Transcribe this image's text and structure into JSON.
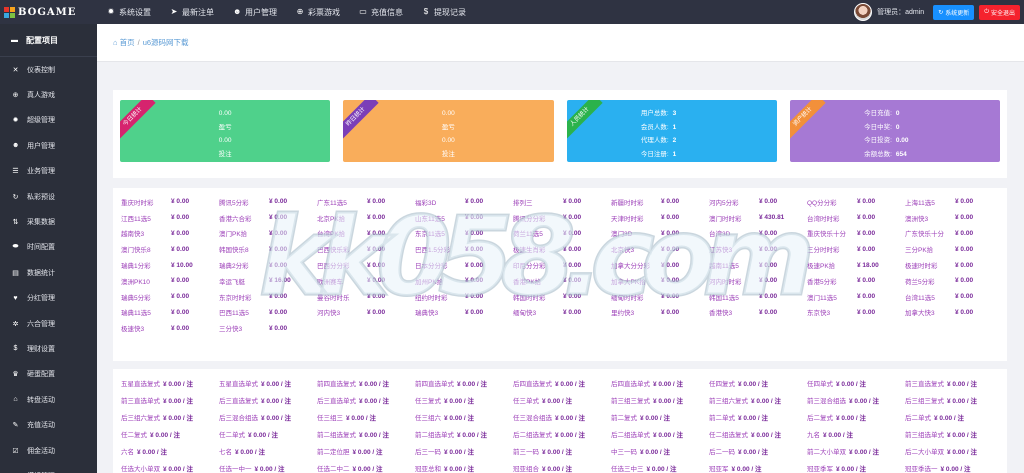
{
  "brand": {
    "logo_text": "BOGAME",
    "logo_colors": [
      "#e8352a",
      "#f7a31c",
      "#3aa8e0",
      "#7dc242"
    ]
  },
  "topnav": [
    {
      "label": "系统设置",
      "icon": "gear-icon",
      "glyph": "✹"
    },
    {
      "label": "最新注单",
      "icon": "paper-plane-icon",
      "glyph": "➤"
    },
    {
      "label": "用户管理",
      "icon": "user-icon",
      "glyph": "☻"
    },
    {
      "label": "彩票游戏",
      "icon": "plus-circle-icon",
      "glyph": "⊕"
    },
    {
      "label": "充值信息",
      "icon": "card-icon",
      "glyph": "▭"
    },
    {
      "label": "提现记录",
      "icon": "dollar-icon",
      "glyph": "$"
    }
  ],
  "top_right": {
    "admin_label": "管理员：admin",
    "update_btn": "系统更新",
    "logout_btn": "安全退出"
  },
  "sidebar": {
    "title": "配置项目",
    "items": [
      {
        "label": "仪表控制",
        "icon": "shuffle-icon",
        "glyph": "✕"
      },
      {
        "label": "真人游戏",
        "icon": "plus-circle-icon",
        "glyph": "⊕"
      },
      {
        "label": "超级管理",
        "icon": "gear-icon",
        "glyph": "✹"
      },
      {
        "label": "用户管理",
        "icon": "user-icon",
        "glyph": "☻"
      },
      {
        "label": "业务管理",
        "icon": "list-icon",
        "glyph": "☰"
      },
      {
        "label": "私彩预设",
        "icon": "refresh-icon",
        "glyph": "↻"
      },
      {
        "label": "采集数据",
        "icon": "sort-icon",
        "glyph": "⇅"
      },
      {
        "label": "时间配置",
        "icon": "car-icon",
        "glyph": "⬬"
      },
      {
        "label": "数据统计",
        "icon": "chart-icon",
        "glyph": "▤"
      },
      {
        "label": "分红管理",
        "icon": "heart-icon",
        "glyph": "♥"
      },
      {
        "label": "六合管理",
        "icon": "cog-icon",
        "glyph": "✲"
      },
      {
        "label": "理财设置",
        "icon": "dollar-icon",
        "glyph": "$"
      },
      {
        "label": "砸蛋配置",
        "icon": "trophy-icon",
        "glyph": "♛"
      },
      {
        "label": "转盘活动",
        "icon": "bank-icon",
        "glyph": "⌂"
      },
      {
        "label": "充值活动",
        "icon": "edit-icon",
        "glyph": "✎"
      },
      {
        "label": "佣金活动",
        "icon": "check-square-icon",
        "glyph": "☑"
      },
      {
        "label": "模板管理",
        "icon": "grid-icon",
        "glyph": "▦"
      }
    ]
  },
  "breadcrumb": {
    "home": "首页",
    "separator": "/",
    "current": "u6源码网下载"
  },
  "stats": [
    {
      "ribbon": "今日统计",
      "color": "#4fd18b",
      "ribbon_color": "#d6246e",
      "layout": "center",
      "lines": [
        "0.00",
        "盈亏",
        "0.00",
        "投注"
      ]
    },
    {
      "ribbon": "昨日统计",
      "color": "#f9ad5b",
      "ribbon_color": "#7b3fb8",
      "layout": "center",
      "lines": [
        "0.00",
        "盈亏",
        "0.00",
        "投注"
      ]
    },
    {
      "ribbon": "人员统计",
      "color": "#2ab0f0",
      "ribbon_color": "#2bb24c",
      "layout": "kv",
      "lines": [
        [
          "用户总数:",
          "3"
        ],
        [
          "会员人数:",
          "1"
        ],
        [
          "代理人数:",
          "2"
        ],
        [
          "今日注册:",
          "1"
        ]
      ]
    },
    {
      "ribbon": "资产统计",
      "color": "#a679d4",
      "ribbon_color": "#f2903a",
      "layout": "kv",
      "lines": [
        [
          "今日充值:",
          "0"
        ],
        [
          "今日中奖:",
          "0"
        ],
        [
          "今日投资:",
          "0.00"
        ],
        [
          "余额总数:",
          "654"
        ]
      ]
    }
  ],
  "lotteries": [
    [
      "重庆时时彩",
      "¥ 0.00"
    ],
    [
      "腾讯5分彩",
      "¥ 0.00"
    ],
    [
      "广东11选5",
      "¥ 0.00"
    ],
    [
      "福彩3D",
      "¥ 0.00"
    ],
    [
      "排列三",
      "¥ 0.00"
    ],
    [
      "新疆时时彩",
      "¥ 0.00"
    ],
    [
      "河内5分彩",
      "¥ 0.00"
    ],
    [
      "QQ分分彩",
      "¥ 0.00"
    ],
    [
      "上海11选5",
      "¥ 0.00"
    ],
    [
      "江西11选5",
      "¥ 0.00"
    ],
    [
      "香港六合彩",
      "¥ 0.00"
    ],
    [
      "北京PK拾",
      "¥ 0.00"
    ],
    [
      "山东11选5",
      "¥ 0.00"
    ],
    [
      "腾讯分分彩",
      "¥ 0.00"
    ],
    [
      "天津时时彩",
      "¥ 0.00"
    ],
    [
      "澳门时时彩",
      "¥ 430.81"
    ],
    [
      "台湾时时彩",
      "¥ 0.00"
    ],
    [
      "澳洲快3",
      "¥ 0.00"
    ],
    [
      "越南快3",
      "¥ 0.00"
    ],
    [
      "澳门PK拾",
      "¥ 0.00"
    ],
    [
      "台湾PK拾",
      "¥ 0.00"
    ],
    [
      "东京11选5",
      "¥ 0.00"
    ],
    [
      "荷兰11选5",
      "¥ 0.00"
    ],
    [
      "澳门3D",
      "¥ 0.00"
    ],
    [
      "台湾3D",
      "¥ 0.00"
    ],
    [
      "重庆快乐十分",
      "¥ 0.00"
    ],
    [
      "广东快乐十分",
      "¥ 0.00"
    ],
    [
      "澳门快乐8",
      "¥ 0.00"
    ],
    [
      "韩国快乐8",
      "¥ 0.00"
    ],
    [
      "巴西快乐彩",
      "¥ 0.00"
    ],
    [
      "巴西1.5分彩",
      "¥ 0.00"
    ],
    [
      "极速生肖彩",
      "¥ 0.00"
    ],
    [
      "北京快3",
      "¥ 0.00"
    ],
    [
      "江苏快3",
      "¥ 0.00"
    ],
    [
      "三分时时彩",
      "¥ 0.00"
    ],
    [
      "三分PK拾",
      "¥ 0.00"
    ],
    [
      "瑞典1分彩",
      "¥ 10.00"
    ],
    [
      "瑞典2分彩",
      "¥ 0.00"
    ],
    [
      "巴西分分彩",
      "¥ 0.00"
    ],
    [
      "日本分分彩",
      "¥ 0.00"
    ],
    [
      "印尼分分彩",
      "¥ 0.00"
    ],
    [
      "加拿大分分彩",
      "¥ 0.00"
    ],
    [
      "越南11选5",
      "¥ 0.00"
    ],
    [
      "极速PK拾",
      "¥ 18.00"
    ],
    [
      "极速时时彩",
      "¥ 0.00"
    ],
    [
      "澳洲PK10",
      "¥ 0.00"
    ],
    [
      "幸运飞艇",
      "¥ 16.00"
    ],
    [
      "欧洲赛车",
      "¥ 0.00"
    ],
    [
      "加州PK拾",
      "¥ 0.00"
    ],
    [
      "香港PK拾",
      "¥ 0.00"
    ],
    [
      "加拿大PK拾",
      "¥ 0.00"
    ],
    [
      "河内时时彩",
      "¥ 0.00"
    ],
    [
      "香港5分彩",
      "¥ 0.00"
    ],
    [
      "荷兰5分彩",
      "¥ 0.00"
    ],
    [
      "瑞典5分彩",
      "¥ 0.00"
    ],
    [
      "东京时时彩",
      "¥ 0.00"
    ],
    [
      "曼谷时时乐",
      "¥ 0.00"
    ],
    [
      "纽约时时彩",
      "¥ 0.00"
    ],
    [
      "韩国时时彩",
      "¥ 0.00"
    ],
    [
      "缅甸时时彩",
      "¥ 0.00"
    ],
    [
      "韩国11选5",
      "¥ 0.00"
    ],
    [
      "澳门11选5",
      "¥ 0.00"
    ],
    [
      "台湾11选5",
      "¥ 0.00"
    ],
    [
      "瑞典11选5",
      "¥ 0.00"
    ],
    [
      "巴西11选5",
      "¥ 0.00"
    ],
    [
      "河内快3",
      "¥ 0.00"
    ],
    [
      "瑞典快3",
      "¥ 0.00"
    ],
    [
      "缅甸快3",
      "¥ 0.00"
    ],
    [
      "里约快3",
      "¥ 0.00"
    ],
    [
      "香港快3",
      "¥ 0.00"
    ],
    [
      "东京快3",
      "¥ 0.00"
    ],
    [
      "加拿大快3",
      "¥ 0.00"
    ],
    [
      "极速快3",
      "¥ 0.00"
    ],
    [
      "三分快3",
      "¥ 0.00"
    ]
  ],
  "plays": [
    [
      "五星直选复式",
      "¥ 0.00 / 注"
    ],
    [
      "五星直选单式",
      "¥ 0.00 / 注"
    ],
    [
      "前四直选复式",
      "¥ 0.00 / 注"
    ],
    [
      "前四直选单式",
      "¥ 0.00 / 注"
    ],
    [
      "后四直选复式",
      "¥ 0.00 / 注"
    ],
    [
      "后四直选单式",
      "¥ 0.00 / 注"
    ],
    [
      "任四复式",
      "¥ 0.00 / 注"
    ],
    [
      "任四单式",
      "¥ 0.00 / 注"
    ],
    [
      "前三直选复式",
      "¥ 0.00 / 注"
    ],
    [
      "前三直选单式",
      "¥ 0.00 / 注"
    ],
    [
      "后三直选复式",
      "¥ 0.00 / 注"
    ],
    [
      "后三直选单式",
      "¥ 0.00 / 注"
    ],
    [
      "任三复式",
      "¥ 0.00 / 注"
    ],
    [
      "任三单式",
      "¥ 0.00 / 注"
    ],
    [
      "前三组三复式",
      "¥ 0.00 / 注"
    ],
    [
      "前三组六复式",
      "¥ 0.00 / 注"
    ],
    [
      "前三混合组选",
      "¥ 0.00 / 注"
    ],
    [
      "后三组三复式",
      "¥ 0.00 / 注"
    ],
    [
      "后三组六复式",
      "¥ 0.00 / 注"
    ],
    [
      "后三混合组选",
      "¥ 0.00 / 注"
    ],
    [
      "任三组三",
      "¥ 0.00 / 注"
    ],
    [
      "任三组六",
      "¥ 0.00 / 注"
    ],
    [
      "任三混合组选",
      "¥ 0.00 / 注"
    ],
    [
      "前二复式",
      "¥ 0.00 / 注"
    ],
    [
      "前二单式",
      "¥ 0.00 / 注"
    ],
    [
      "后二复式",
      "¥ 0.00 / 注"
    ],
    [
      "后二单式",
      "¥ 0.00 / 注"
    ],
    [
      "任二复式",
      "¥ 0.00 / 注"
    ],
    [
      "任二单式",
      "¥ 0.00 / 注"
    ],
    [
      "前二组选复式",
      "¥ 0.00 / 注"
    ],
    [
      "前二组选单式",
      "¥ 0.00 / 注"
    ],
    [
      "后二组选复式",
      "¥ 0.00 / 注"
    ],
    [
      "后二组选单式",
      "¥ 0.00 / 注"
    ],
    [
      "任二组选复式",
      "¥ 0.00 / 注"
    ],
    [
      "九名",
      "¥ 0.00 / 注"
    ],
    [
      "前三组选单式",
      "¥ 0.00 / 注"
    ],
    [
      "六名",
      "¥ 0.00 / 注"
    ],
    [
      "七名",
      "¥ 0.00 / 注"
    ],
    [
      "前二定位胆",
      "¥ 0.00 / 注"
    ],
    [
      "后三一码",
      "¥ 0.00 / 注"
    ],
    [
      "前三一码",
      "¥ 0.00 / 注"
    ],
    [
      "中三一码",
      "¥ 0.00 / 注"
    ],
    [
      "后二一码",
      "¥ 0.00 / 注"
    ],
    [
      "前二大小单双",
      "¥ 0.00 / 注"
    ],
    [
      "后二大小单双",
      "¥ 0.00 / 注"
    ],
    [
      "任选大小单双",
      "¥ 0.00 / 注"
    ],
    [
      "任选一中一",
      "¥ 0.00 / 注"
    ],
    [
      "任选二中二",
      "¥ 0.00 / 注"
    ],
    [
      "冠亚总和",
      "¥ 0.00 / 注"
    ],
    [
      "冠亚组合",
      "¥ 0.00 / 注"
    ],
    [
      "任选三中三",
      "¥ 0.00 / 注"
    ],
    [
      "冠亚军",
      "¥ 0.00 / 注"
    ],
    [
      "冠亚季军",
      "¥ 0.00 / 注"
    ],
    [
      "冠亚季选一",
      "¥ 0.00 / 注"
    ]
  ],
  "watermark_text": "kk058.com"
}
